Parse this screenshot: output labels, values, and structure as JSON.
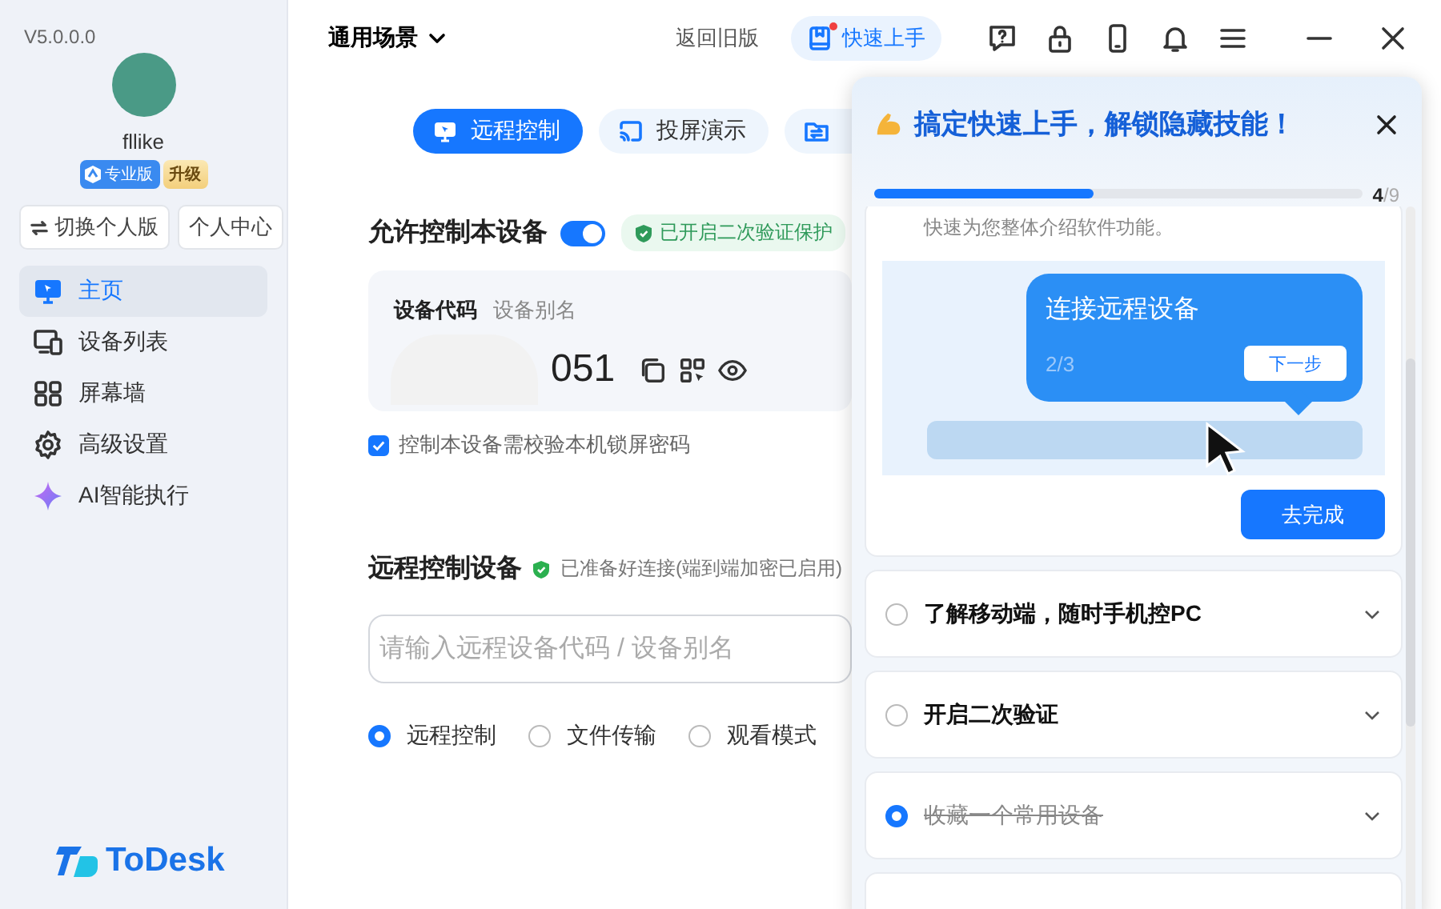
{
  "sidebar": {
    "version": "V5.0.0.0",
    "user": {
      "name": "fllike",
      "edition": "专业版",
      "upgrade": "升级"
    },
    "buttons": [
      {
        "label": "切换个人版",
        "kind": "switch"
      },
      {
        "label": "个人中心",
        "kind": "plain"
      }
    ],
    "nav": [
      {
        "label": "主页",
        "selected": true
      },
      {
        "label": "设备列表",
        "selected": false
      },
      {
        "label": "屏幕墙",
        "selected": false
      },
      {
        "label": "高级设置",
        "selected": false
      },
      {
        "label": "AI智能执行",
        "selected": false
      }
    ],
    "logo": "ToDesk"
  },
  "topbar": {
    "scene": "通用场景",
    "legacy_link": "返回旧版",
    "quick_start": {
      "label": "快速上手",
      "notification": true
    }
  },
  "mode_tabs": [
    {
      "label": "远程控制",
      "selected": true
    },
    {
      "label": "投屏演示",
      "selected": false
    },
    {
      "selected": false
    }
  ],
  "allow_control": {
    "title": "允许控制本设备",
    "on": true,
    "badge": "已开启二次验证保护",
    "code_tabs": [
      {
        "label": "设备代码",
        "selected": true
      },
      {
        "label": "设备别名",
        "selected": false
      }
    ],
    "code": "051",
    "lock_password": {
      "label": "控制本设备需校验本机锁屏密码",
      "checked": true
    }
  },
  "remote_control": {
    "title": "远程控制设备",
    "status": "已准备好连接(端到端加密已启用)",
    "input": {
      "placeholder": "请输入远程设备代码 / 设备别名"
    },
    "modes": [
      {
        "label": "远程控制",
        "selected": true
      },
      {
        "label": "文件传输",
        "selected": false
      },
      {
        "label": "观看模式",
        "selected": false
      }
    ]
  },
  "guide": {
    "title": "搞定快速上手，解锁隐藏技能！",
    "progress": {
      "level": 0.45,
      "current": "4",
      "total": "/9"
    },
    "current": {
      "description": "快速为您整体介绍软件功能。",
      "demo": {
        "title": "连接远程设备",
        "step": "2/3",
        "next": "下一步"
      },
      "action": "去完成"
    },
    "tasks": [
      {
        "title": "了解移动端，随时手机控PC",
        "completed": false
      },
      {
        "title": "开启二次验证",
        "completed": false
      },
      {
        "title": "收藏一个常用设备",
        "completed": true
      }
    ]
  }
}
